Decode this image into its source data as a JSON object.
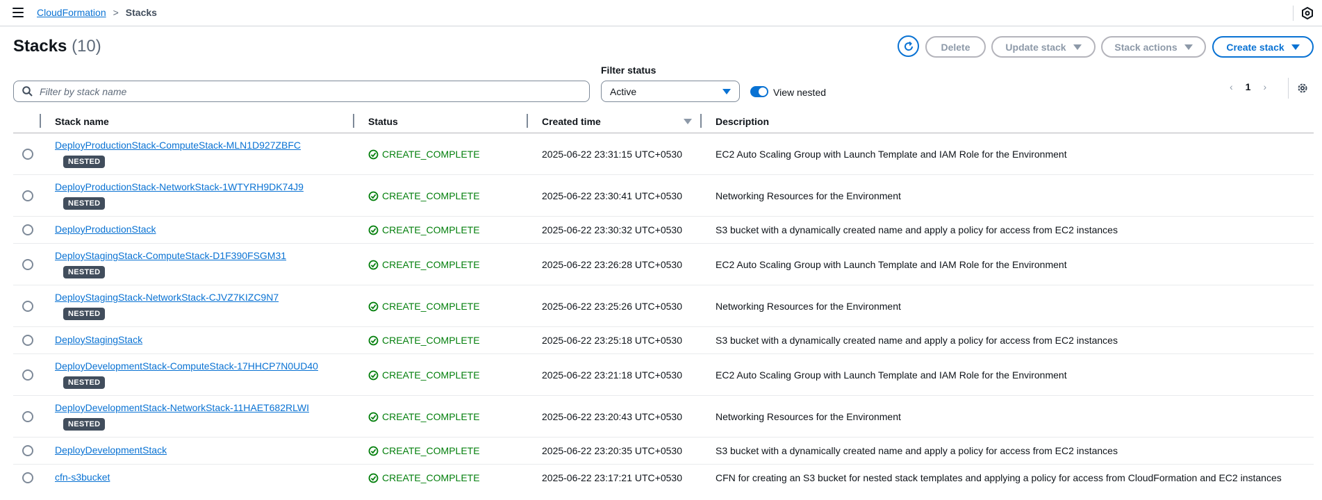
{
  "breadcrumb": {
    "root": "CloudFormation",
    "separator": ">",
    "current": "Stacks"
  },
  "header": {
    "title": "Stacks",
    "count": "(10)"
  },
  "actions": {
    "delete": "Delete",
    "update": "Update stack",
    "stack_actions": "Stack actions",
    "create": "Create stack"
  },
  "filter": {
    "search_placeholder": "Filter by stack name",
    "status_label": "Filter status",
    "status_value": "Active",
    "view_nested_label": "View nested",
    "view_nested_on": true
  },
  "pagination": {
    "prev": "‹",
    "page": "1",
    "next": "›"
  },
  "table": {
    "columns": {
      "name": "Stack name",
      "status": "Status",
      "created": "Created time",
      "description": "Description"
    },
    "rows": [
      {
        "name": "DeployProductionStack-ComputeStack-MLN1D927ZBFC",
        "nested": "NESTED",
        "status": "CREATE_COMPLETE",
        "created": "2025-06-22 23:31:15 UTC+0530",
        "description": "EC2 Auto Scaling Group with Launch Template and IAM Role for the Environment"
      },
      {
        "name": "DeployProductionStack-NetworkStack-1WTYRH9DK74J9",
        "nested": "NESTED",
        "status": "CREATE_COMPLETE",
        "created": "2025-06-22 23:30:41 UTC+0530",
        "description": "Networking Resources for the Environment"
      },
      {
        "name": "DeployProductionStack",
        "status": "CREATE_COMPLETE",
        "created": "2025-06-22 23:30:32 UTC+0530",
        "description": "S3 bucket with a dynamically created name and apply a policy for access from EC2 instances"
      },
      {
        "name": "DeployStagingStack-ComputeStack-D1F390FSGM31",
        "nested": "NESTED",
        "status": "CREATE_COMPLETE",
        "created": "2025-06-22 23:26:28 UTC+0530",
        "description": "EC2 Auto Scaling Group with Launch Template and IAM Role for the Environment"
      },
      {
        "name": "DeployStagingStack-NetworkStack-CJVZ7KIZC9N7",
        "nested": "NESTED",
        "status": "CREATE_COMPLETE",
        "created": "2025-06-22 23:25:26 UTC+0530",
        "description": "Networking Resources for the Environment"
      },
      {
        "name": "DeployStagingStack",
        "status": "CREATE_COMPLETE",
        "created": "2025-06-22 23:25:18 UTC+0530",
        "description": "S3 bucket with a dynamically created name and apply a policy for access from EC2 instances"
      },
      {
        "name": "DeployDevelopmentStack-ComputeStack-17HHCP7N0UD40",
        "nested": "NESTED",
        "status": "CREATE_COMPLETE",
        "created": "2025-06-22 23:21:18 UTC+0530",
        "description": "EC2 Auto Scaling Group with Launch Template and IAM Role for the Environment"
      },
      {
        "name": "DeployDevelopmentStack-NetworkStack-11HAET682RLWI",
        "nested": "NESTED",
        "status": "CREATE_COMPLETE",
        "created": "2025-06-22 23:20:43 UTC+0530",
        "description": "Networking Resources for the Environment"
      },
      {
        "name": "DeployDevelopmentStack",
        "status": "CREATE_COMPLETE",
        "created": "2025-06-22 23:20:35 UTC+0530",
        "description": "S3 bucket with a dynamically created name and apply a policy for access from EC2 instances"
      },
      {
        "name": "cfn-s3bucket",
        "status": "CREATE_COMPLETE",
        "created": "2025-06-22 23:17:21 UTC+0530",
        "description": "CFN for creating an S3 bucket for nested stack templates and applying a policy for access from CloudFormation and EC2 instances"
      }
    ]
  },
  "colors": {
    "link": "#0972d3",
    "success": "#037f0c",
    "badge_bg": "#414d5c",
    "disabled": "#8d99a8"
  },
  "icons": {
    "menu": "hamburger-icon",
    "refresh": "refresh-icon",
    "search": "search-icon",
    "status_ok": "check-circle-icon",
    "settings": "gear-icon"
  }
}
